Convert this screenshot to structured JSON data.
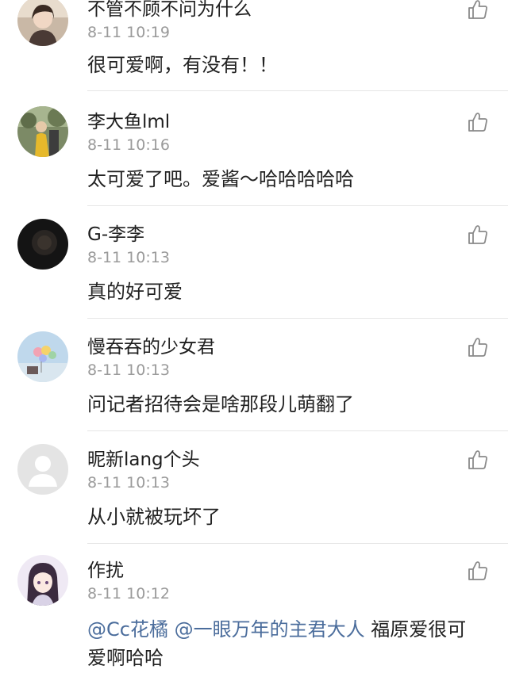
{
  "comments": [
    {
      "username": "不管不顾不问为什么",
      "time": "8-11 10:19",
      "text": "很可爱啊，有没有！！",
      "avatar": "girl-photo-avatar",
      "like_icon": "thumbs-up-icon"
    },
    {
      "username": "李大鱼lml",
      "time": "8-11 10:16",
      "text": "太可爱了吧。爱酱～哈哈哈哈哈",
      "avatar": "person-outdoors-avatar",
      "like_icon": "thumbs-up-icon"
    },
    {
      "username": "G-李李",
      "time": "8-11 10:13",
      "text": "真的好可爱",
      "avatar": "dark-photo-avatar",
      "like_icon": "thumbs-up-icon"
    },
    {
      "username": "慢吞吞的少女君",
      "time": "8-11 10:13",
      "text": "问记者招待会是啥那段儿萌翻了",
      "avatar": "balloons-avatar",
      "like_icon": "thumbs-up-icon"
    },
    {
      "username": "昵新lang个头",
      "time": "8-11 10:13",
      "text": "从小就被玩坏了",
      "avatar": "default-user-avatar",
      "like_icon": "thumbs-up-icon"
    },
    {
      "username": "作扰",
      "time": "8-11 10:12",
      "mention1": "@Cc花橘",
      "mention2": "@一眼万年的主君大人",
      "text": "福原爱很可爱啊哈哈",
      "avatar": "anime-girl-avatar",
      "like_icon": "thumbs-up-icon"
    }
  ],
  "colors": {
    "mention": "#4b6d9c",
    "timestamp": "#9a9a9a",
    "divider": "#e6e6e6"
  }
}
